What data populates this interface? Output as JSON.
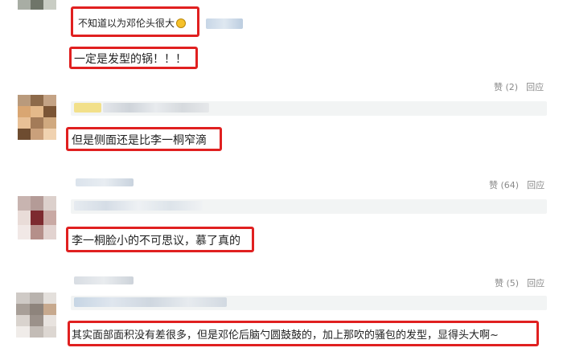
{
  "comments": [
    {
      "reply_text": "不知道以为邓伦头很大",
      "reply_emoji": "grin-emoji",
      "followup_text": "一定是发型的锅！！！"
    },
    {
      "likes_label": "赞 (2)",
      "reply_label": "回应",
      "text": "但是侧面还是比李一桐窄滴"
    },
    {
      "likes_label": "赞 (64)",
      "reply_label": "回应",
      "text": "李一桐脸小的不可思议，慕了真的"
    },
    {
      "likes_label": "赞 (5)",
      "reply_label": "回应",
      "text": "其实面部面积没有差很多，但是邓伦后脑勺圆鼓鼓的，加上那吹的骚包的发型，显得头大啊~"
    }
  ],
  "colors": {
    "highlight": "#e02020",
    "muted_text": "#999999",
    "band": "#f2f4f4"
  }
}
